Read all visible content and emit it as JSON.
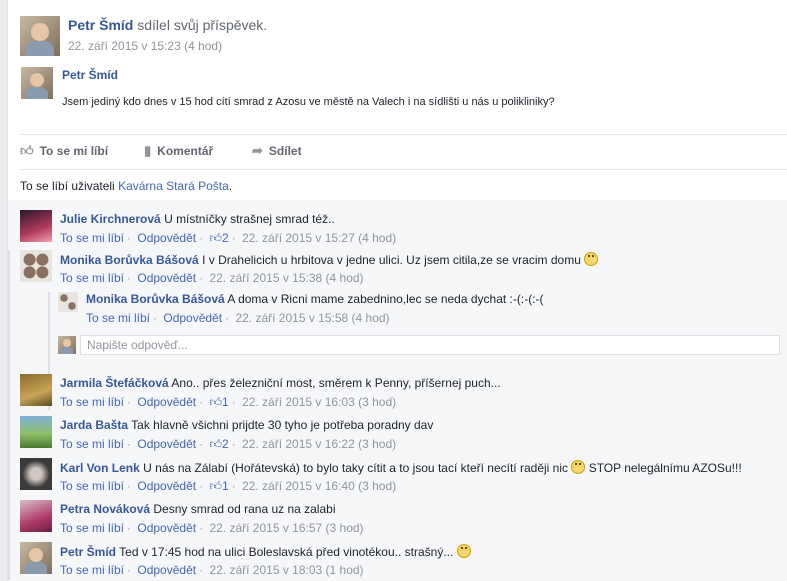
{
  "post": {
    "author": "Petr Šmíd",
    "action": "sdílel svůj příspěvek.",
    "time": "22. září 2015 v 15:23 (4 hod)",
    "shared_author": "Petr Šmíd",
    "text": "Jsem jediný kdo dnes v 15 hod cítí smrad z Azosu ve městě na Valech i na sídlišti u nás u polikliniky?"
  },
  "actions": {
    "like": "To se mi líbí",
    "comment": "Komentář",
    "share": "Sdílet"
  },
  "likes_line": {
    "prefix": "To se líbí uživateli",
    "user": "Kavárna Stará Pošta",
    "suffix": "."
  },
  "comment_meta": {
    "like": "To se mi líbí",
    "reply": "Odpovědět"
  },
  "comments": [
    {
      "author": "Julie Kirchnerová",
      "text": "U místníčky strašnej smrad též..",
      "likes": "2",
      "time": "22. září 2015 v 15:27 (4 hod)"
    },
    {
      "author": "Monika Borůvka Bášová",
      "text": "I v Drahelicich u hrbitova v jedne ulici. Uz jsem citila,ze se vracim domu",
      "likes": "",
      "time": "22. září 2015 v 15:38 (4 hod)"
    },
    {
      "author": "Jarmila Štefáčková",
      "text": "Ano.. přes železniční most, směrem k Penny, příšernej puch...",
      "likes": "1",
      "time": "22. září 2015 v 16:03 (3 hod)"
    },
    {
      "author": "Jarda Bašta",
      "text": "Tak hlavně všichni prijdte 30 tyho je potřeba poradny dav",
      "likes": "2",
      "time": "22. září 2015 v 16:22 (3 hod)"
    },
    {
      "author": "Karl Von Lenk",
      "text": "U nás na Zálabí (Hořátevská) to bylo taky cítit a to jsou tací kteří necítí raději nic",
      "text2": "STOP nelegálnímu AZOSu!!!",
      "likes": "1",
      "time": "22. září 2015 v 16:40 (3 hod)"
    },
    {
      "author": "Petra Nováková",
      "text": "Desny smrad od rana uz na zalabi",
      "likes": "",
      "time": "22. září 2015 v 16:57 (3 hod)"
    },
    {
      "author": "Petr Šmíd",
      "text": "Ted v 17:45 hod na ulici Boleslavská před vinotékou.. strašný...",
      "likes": "",
      "time": "22. září 2015 v 18:03 (1 hod)"
    }
  ],
  "reply": {
    "author": "Monika Borůvka Bášová",
    "text": "A doma v Ricni mame zabednino,lec se neda dychat :-(:-(:-(",
    "time": "22. září 2015 v 15:58 (4 hod)",
    "placeholder": "Napište odpověď..."
  },
  "colors": {
    "link": "#365899",
    "meta": "#90949c",
    "bg": "#f6f7f9"
  }
}
